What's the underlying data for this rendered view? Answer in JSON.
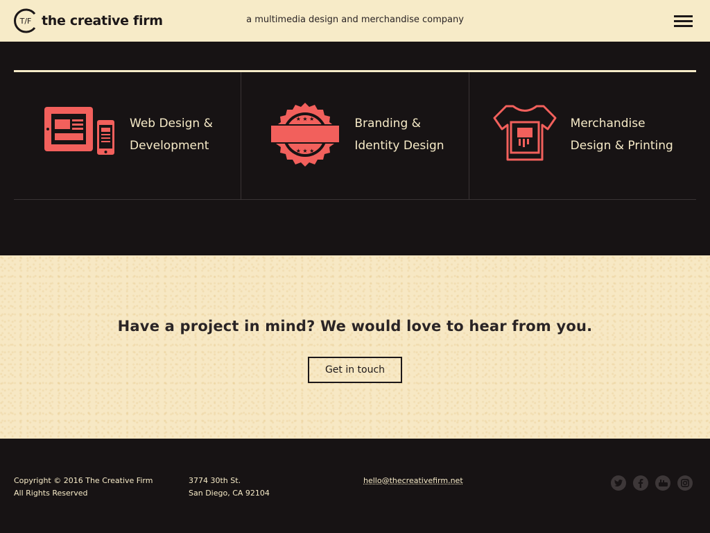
{
  "header": {
    "logo_mark": "T/F",
    "logo_text": "the creative firm",
    "tagline": "a multimedia design and merchandise company",
    "menu_icon": "hamburger-icon"
  },
  "services": [
    {
      "icon": "devices-icon",
      "line1": "Web Design &",
      "line2": "Development"
    },
    {
      "icon": "badge-icon",
      "line1": "Branding &",
      "line2": "Identity Design"
    },
    {
      "icon": "tshirt-icon",
      "line1": "Merchandise",
      "line2": "Design & Printing"
    }
  ],
  "cta": {
    "heading": "Have a project in mind? We would love to hear from you.",
    "button": "Get in touch"
  },
  "footer": {
    "copyright_line1": "Copyright © 2016 The Creative Firm",
    "copyright_line2": "All Rights Reserved",
    "address_line1": "3774 30th St.",
    "address_line2": "San Diego, CA 92104",
    "email": "hello@thecreativefirm.net",
    "social": [
      "twitter-icon",
      "facebook-icon",
      "youtube-icon",
      "instagram-icon"
    ]
  },
  "colors": {
    "accent": "#f2605c",
    "cream": "#f7ebc8",
    "dark": "#171314"
  }
}
